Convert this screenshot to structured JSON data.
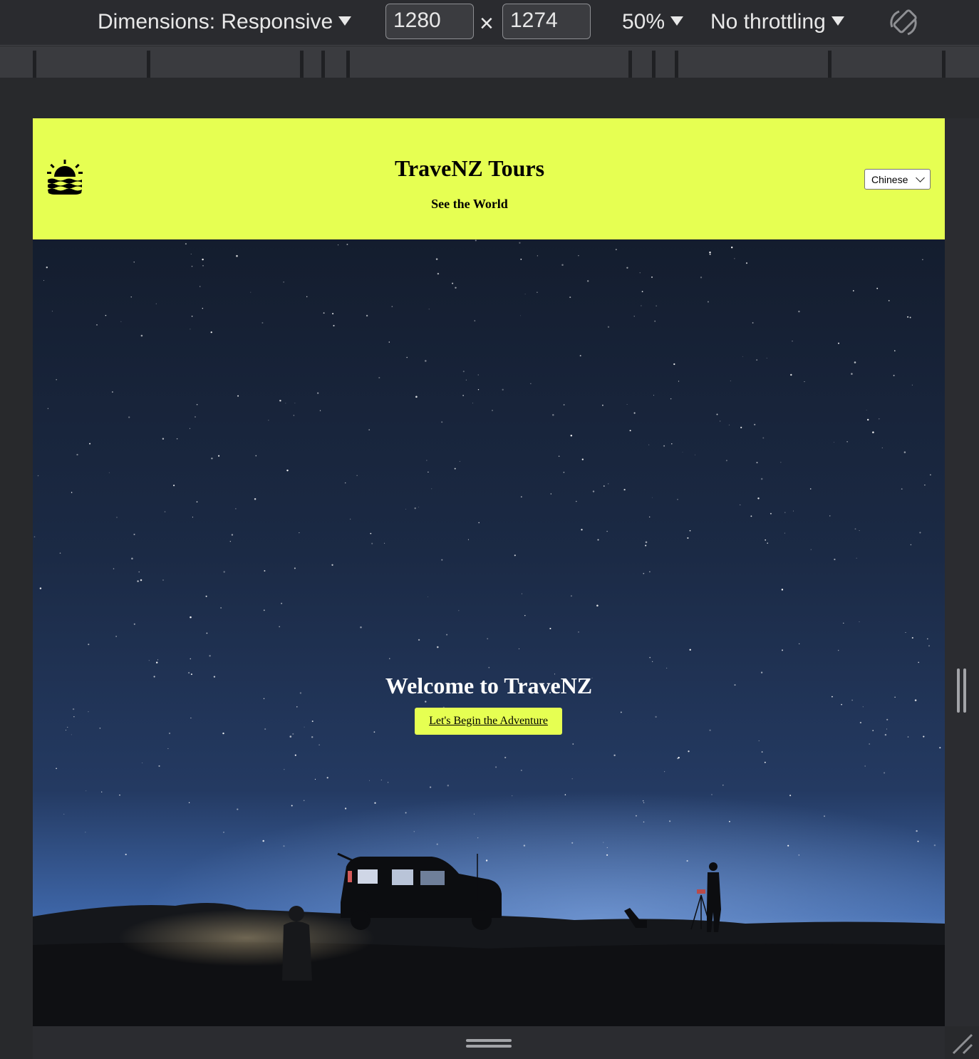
{
  "devtools": {
    "dimensions_label": "Dimensions: Responsive",
    "width_value": "1280",
    "times_symbol": "×",
    "height_value": "1274",
    "zoom": "50%",
    "throttling": "No throttling",
    "rotate_icon": "rotate-device-icon"
  },
  "site": {
    "logo_icon": "sunset-icon",
    "title": "TraveNZ Tours",
    "tagline": "See the World",
    "language_selected": "Chinese",
    "colors": {
      "header_bg": "#e6ff52",
      "button_bg": "#e6ff52"
    }
  },
  "hero": {
    "heading": "Welcome to TraveNZ",
    "cta_label": "Let's Begin the Adventure"
  }
}
